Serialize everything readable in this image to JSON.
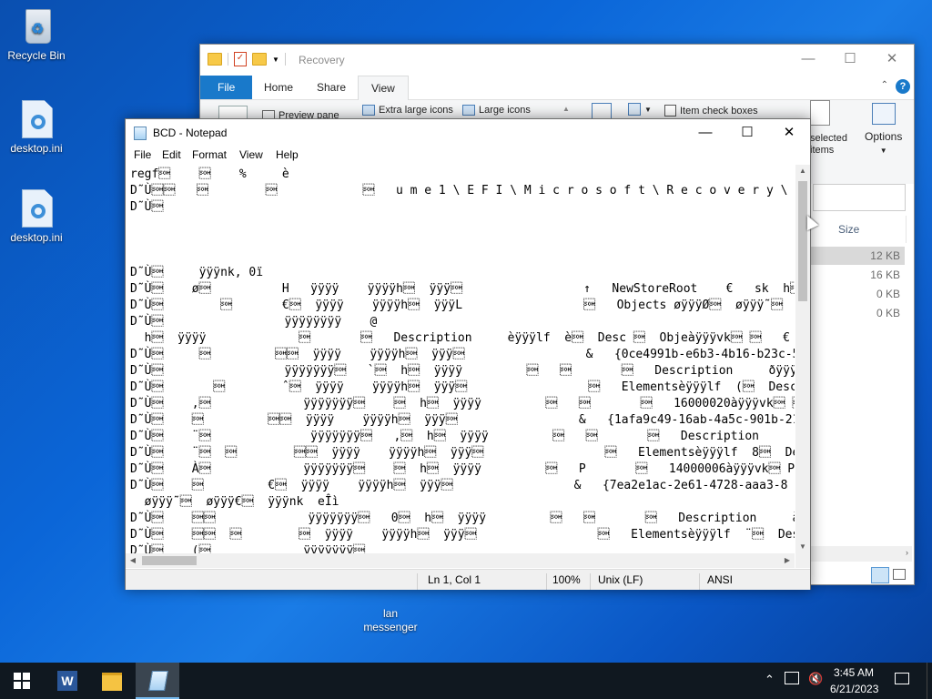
{
  "desktop": {
    "icons": [
      {
        "label": "Recycle Bin"
      },
      {
        "label": "desktop.ini"
      },
      {
        "label": "desktop.ini"
      },
      {
        "label": "lan\nmessenger"
      }
    ]
  },
  "explorer": {
    "title": "Recovery",
    "tabs": [
      "File",
      "Home",
      "Share",
      "View"
    ],
    "ribbon": {
      "preview_pane": "Preview pane",
      "extra_large_icons": "Extra large icons",
      "large_icons": "Large icons",
      "item_check_boxes": "Item check boxes",
      "hide_selected": "selected\nitems",
      "options": "Options"
    },
    "column_size": "Size",
    "sizes": [
      "12 KB",
      "16 KB",
      "0 KB",
      "0 KB"
    ]
  },
  "notepad": {
    "title": "BCD - Notepad",
    "menu": [
      "File",
      "Edit",
      "Format",
      "View",
      "Help"
    ],
    "content": "regf\u0001    \u0001    %     è\nD˜Ù\u0001\u0001   \u0001        \u0001            \u0001   u m e 1 \\ E F I \\ M i c r o s o f t \\ R e c o v e r y \\ B C D\nD˜Ù\u0001\n\n\n\nD˜Ù\u0001     ÿÿÿnk, 0ï\nD˜Ù\u0001    ø\u0001          H   ÿÿÿÿ    ÿÿÿÿh\u0001  ÿÿÿ\u0001                 ↑   NewStoreRoot    €   sk  h\u0001\nD˜Ù\u0001        \u0001       €\u0001  ÿÿÿÿ    ÿÿÿÿh\u0001  ÿÿÿL                 \u0001   Objects øÿÿÿØ\u0001  øÿÿÿ˜\u0001  €ÿÿ\nD˜Ù\u0001                 ÿÿÿÿÿÿÿÿ    @\n  h\u0001  ÿÿÿÿ             \u0001       \u0001   Description     èÿÿÿlf  è\u0001  Desc \u0001  Objeàÿÿÿvk\u0001 \u0001   €   \u0001   \u0001\nD˜Ù\u0001     \u0001         \u0001\u0001  ÿÿÿÿ    ÿÿÿÿh\u0001  ÿÿÿ\u0001                 &   {0ce4991b-e6b3-4b16-b23c-5e\nD˜Ù\u0001                 ÿÿÿÿÿÿÿ\u0001   `\u0001  h\u0001  ÿÿÿÿ         \u0001   \u0001       \u0001   Description     ðÿÿÿlf\u0001 (\u0001\nD˜Ù\u0001       \u0001        ˆ\u0001  ÿÿÿÿ    ÿÿÿÿh\u0001  ÿÿÿ\u0001                 \u0001   Elementsèÿÿÿlf  (\u0001  Desc.\u0001\nD˜Ù\u0001    ,\u0001             ÿÿÿÿÿÿÿ\u0001    \u0001  h\u0001  ÿÿÿÿ         \u0001   \u0001       \u0001   16000020àÿÿÿvk\u0001 \u0001  €    \u0001   \u0001\nD˜Ù\u0001    \u0001         \u0001\u0001  ÿÿÿÿ    ÿÿÿÿh\u0001  ÿÿÿ\u0001                 &   {1afa9c49-16ab-4a5c-901b-21\nD˜Ù\u0001    ¨\u0001              ÿÿÿÿÿÿÿ\u0001   ,\u0001  h\u0001  ÿÿÿÿ         \u0001   \u0001       \u0001   Description     àÿÿÿvk\u0001 \u0001  €\u0001\nD˜Ù\u0001    ¨\u0001  \u0001        \u0001\u0001  ÿÿÿÿ    ÿÿÿÿh\u0001  ÿÿÿ\u0001                 \u0001   Elementsèÿÿÿlf  8\u0001  DescÀ\u0001  E\nD˜Ù\u0001    À\u0001             ÿÿÿÿÿÿÿ\u0001    \u0001  h\u0001  ÿÿÿÿ         \u0001   P       \u0001   14000006àÿÿÿvk\u0001 P   ¨\u0001  \u0001   \u0001\nD˜Ù\u0001    \u0001         €\u0001  ÿÿÿÿ    ÿÿÿÿh\u0001  ÿÿÿ\u0001                 &   {7ea2e1ac-2e61-4728-aaa3-8\n  øÿÿÿ˜\u0001  øÿÿÿ€\u0001  ÿÿÿnk  eÎì\nD˜Ù\u0001    \u0001\u0001             ÿÿÿÿÿÿÿ\u0001   0\u0001  h\u0001  ÿÿÿÿ         \u0001   \u0001       \u0001   Description     àÿÿÿvk\u0001 \u0001  €\nD˜Ù\u0001    \u0001\u0001  \u0001        \u0001  ÿÿÿÿ    ÿÿÿÿh\u0001  ÿÿÿ\u0001                 \u0001   Elementsèÿÿÿlf  ¨\u0001  Desc(\u0001  E\nD˜Ù\u0001    (\u0001             ÿÿÿÿÿÿÿ\u0001",
    "status": {
      "position": "Ln 1, Col 1",
      "zoom": "100%",
      "line_ending": "Unix (LF)",
      "encoding": "ANSI"
    }
  },
  "taskbar": {
    "time": "3:45 AM",
    "date": "6/21/2023"
  },
  "colors": {
    "file_tab": "#1979ca",
    "taskbar": "#101820"
  }
}
